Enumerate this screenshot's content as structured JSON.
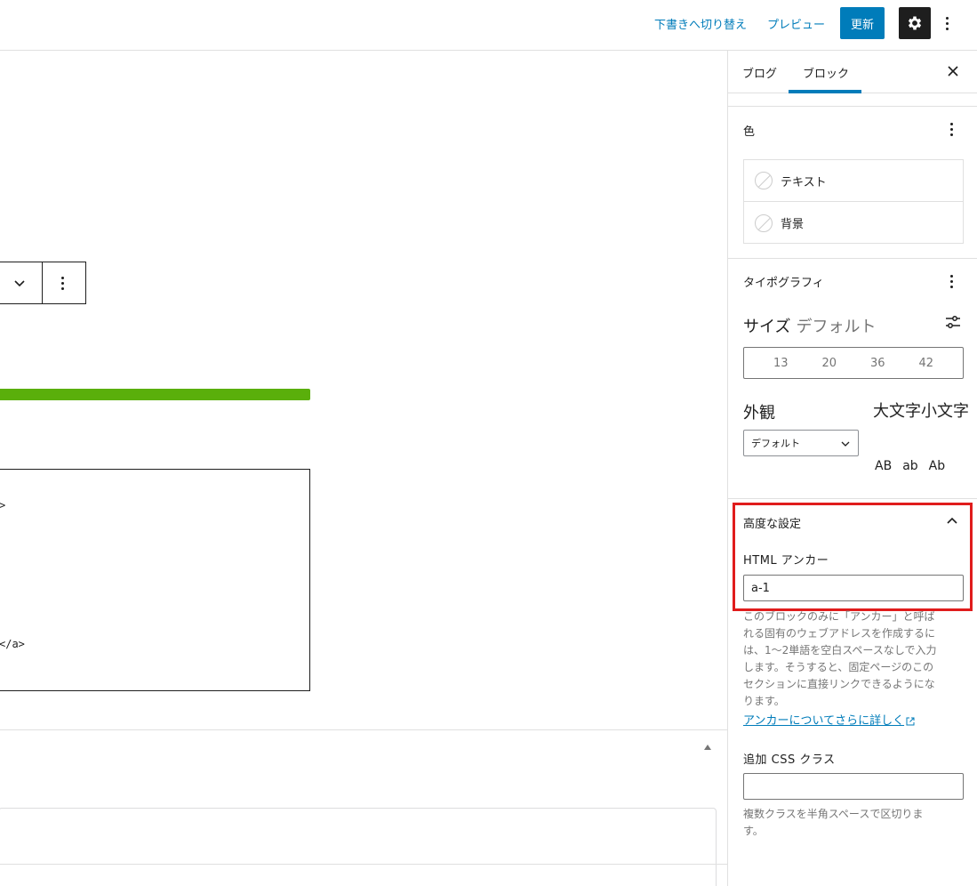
{
  "topbar": {
    "switch_draft": "下書きへ切り替え",
    "preview": "プレビュー",
    "update": "更新"
  },
  "editor": {
    "code_lines": [
      ">",
      "</a>"
    ]
  },
  "sidebar": {
    "tabs": [
      "ブログ",
      "ブロック"
    ],
    "color": {
      "title": "色",
      "items": [
        "テキスト",
        "背景"
      ]
    },
    "typography": {
      "title": "タイポグラフィ",
      "size_label": "サイズ",
      "size_value": "デフォルト",
      "sizes": [
        "13",
        "20",
        "36",
        "42"
      ],
      "appearance_label": "外観",
      "appearance_value": "デフォルト",
      "case_label": "大文字小文字",
      "case_options": [
        "AB",
        "ab",
        "Ab"
      ]
    },
    "advanced": {
      "title": "高度な設定",
      "anchor_label": "HTML アンカー",
      "anchor_value": "a-1",
      "anchor_help": [
        "このブロックのみに「アンカー」と呼ば",
        "れる固有のウェブアドレスを作成するに",
        "は、1〜2単語を空白スペースなしで入力",
        "します。そうすると、固定ページのこの",
        "セクションに直接リンクできるようにな",
        "ります。"
      ],
      "anchor_link": "アンカーについてさらに詳しく",
      "css_label": "追加 CSS クラス",
      "css_value": "",
      "css_help": [
        "複数クラスを半角スペースで区切りま",
        "す。"
      ]
    }
  }
}
